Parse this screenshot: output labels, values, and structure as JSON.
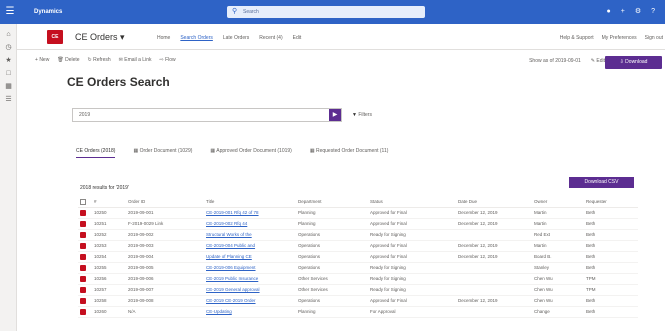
{
  "topbar": {
    "app_name": "Dynamics",
    "search_placeholder": "Search",
    "icons": [
      "lightbulb-icon",
      "plus-icon",
      "settings-icon",
      "help-icon"
    ]
  },
  "header": {
    "logo_text": "CE",
    "title": "CE Orders",
    "title_icon": "chevron-down-icon",
    "nav": [
      "Home",
      "Search Orders",
      "Late Orders",
      "Recent (4)",
      "Edit"
    ],
    "nav_active": 1,
    "right": [
      "Help & Support",
      "My Preferences",
      "Sign out"
    ]
  },
  "commands": {
    "left": [
      "New",
      "Delete",
      "Refresh",
      "Email a Link",
      "Flow"
    ],
    "right": [
      "Show as of 2019-09-01",
      "Edit"
    ],
    "primary": "Download"
  },
  "page": {
    "title": "CE Orders Search"
  },
  "search": {
    "value": "2019",
    "filters_label": "Filters"
  },
  "query_tabs": [
    {
      "label": "CE Orders (2018)",
      "active": true
    },
    {
      "label": "Order Document (1029)",
      "active": false
    },
    {
      "label": "Approved Order Document (1019)",
      "active": false
    },
    {
      "label": "Requested Order Document (11)",
      "active": false
    }
  ],
  "grid": {
    "label": "2018 results for '2019'",
    "export_label": "Download CSV",
    "columns": [
      "",
      "#",
      "Order ID",
      "Title",
      "Department",
      "Status",
      "Date Due",
      "Owner",
      "Requester"
    ],
    "rows": [
      [
        "",
        "10250",
        "2019-09-001",
        "CE-2019-001 Rfq 42 of 78",
        "Planning",
        "Approved for Final",
        "December 12, 2019",
        "Martin",
        "Beth"
      ],
      [
        "",
        "10251",
        "F-2019-0029 Link",
        "CE-2019-002 Rfq 44",
        "Planning",
        "Approved for Final",
        "December 12, 2019",
        "Martin",
        "Beth"
      ],
      [
        "",
        "10252",
        "2019-09-002",
        "Structural Works of the",
        "Operations",
        "Ready for Signing",
        "",
        "Red Ext",
        "Beth"
      ],
      [
        "",
        "10253",
        "2019-09-003",
        "CE-2019-004 Public and",
        "Operations",
        "Approved for Final",
        "December 12, 2019",
        "Martin",
        "Beth"
      ],
      [
        "",
        "10254",
        "2019-09-004",
        "Update of Planning CE",
        "Operations",
        "Approved for Final",
        "December 12, 2019",
        "Board B.",
        "Beth"
      ],
      [
        "",
        "10255",
        "2019-09-005",
        "CE-2019-006 Equipment",
        "Operations",
        "Ready for Signing",
        "",
        "Stanley",
        "Beth"
      ],
      [
        "",
        "10256",
        "2019-09-006",
        "CE-2019 Public Insurance",
        "Other Services",
        "Ready for Signing",
        "",
        "Chen Wu",
        "TPM"
      ],
      [
        "",
        "10257",
        "2019-09-007",
        "CE-2019 General approval",
        "Other Services",
        "Ready for Signing",
        "",
        "Chen Wu",
        "TPM"
      ],
      [
        "",
        "10258",
        "2019-09-008",
        "CE-2019 CE-2019 Order",
        "Operations",
        "Approved for Final",
        "December 12, 2019",
        "Chen Wu",
        "Beth"
      ],
      [
        "",
        "10260",
        "N/A",
        "CE-Updating",
        "Planning",
        "For Approval",
        "",
        "Change",
        "Beth"
      ]
    ]
  },
  "colors": {
    "topbar": "#2e63c6",
    "accent": "#5c2d91",
    "logo": "#c50f1f",
    "link": "#2e63c6"
  }
}
